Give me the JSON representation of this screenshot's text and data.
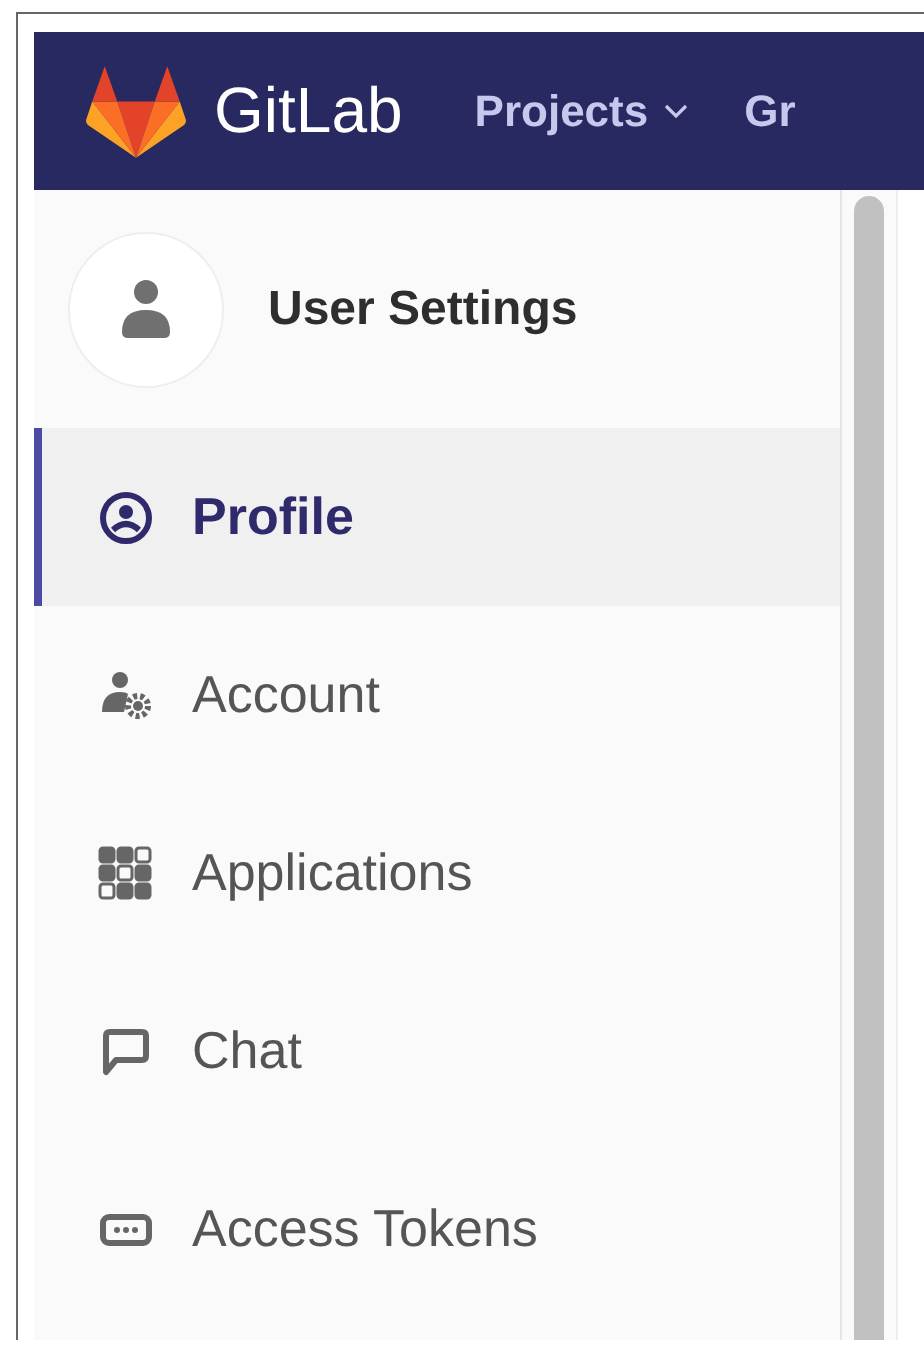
{
  "navbar": {
    "brand": "GitLab",
    "menus": [
      {
        "label": "Projects",
        "dropdown": true
      },
      {
        "label": "Gr",
        "dropdown": false
      }
    ]
  },
  "sidebar": {
    "title": "User Settings",
    "items": [
      {
        "label": "Profile",
        "kind": "profile",
        "selected": true
      },
      {
        "label": "Account",
        "kind": "account",
        "selected": false
      },
      {
        "label": "Applications",
        "kind": "applications",
        "selected": false
      },
      {
        "label": "Chat",
        "kind": "chat",
        "selected": false
      },
      {
        "label": "Access Tokens",
        "kind": "tokens",
        "selected": false
      }
    ]
  }
}
